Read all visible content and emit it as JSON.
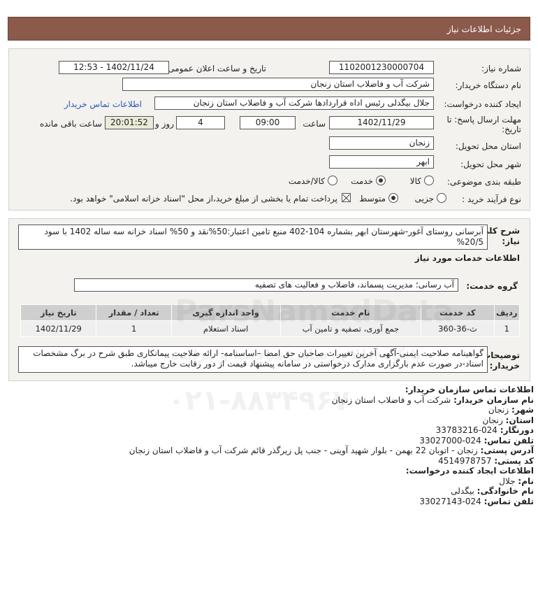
{
  "header": {
    "title": "جزئیات اطلاعات نیاز"
  },
  "form": {
    "need_number_label": "شماره نیاز:",
    "need_number": "1102001230000704",
    "announce_label": "تاریخ و ساعت اعلان عمومی:",
    "announce_value": "1402/11/24 - 12:53",
    "buyer_label": "نام دستگاه خریدار:",
    "buyer_value": "شرکت آب و فاضلاب استان زنجان",
    "creator_label": "ایجاد کننده درخواست:",
    "creator_value": "جلال بیگدلی رئیس اداه قراردادها شرکت آب و فاضلاب استان زنجان",
    "contact_link": "اطلاعات تماس خریدار",
    "deadline_label_1": "مهلت ارسال پاسخ: تا",
    "deadline_label_2": "تاریخ:",
    "deadline_date": "1402/11/29",
    "time_label": "ساعت",
    "deadline_time": "09:00",
    "days_value": "4",
    "days_label": "روز و",
    "remaining_time": "20:01:52",
    "remaining_label": "ساعت باقی مانده",
    "province_label": "استان محل تحویل:",
    "province_value": "زنجان",
    "city_label": "شهر محل تحویل:",
    "city_value": "ابهر",
    "category_label": "طبقه بندی موضوعی:",
    "category_options": [
      "کالا",
      "خدمت",
      "کالا/خدمت"
    ],
    "category_selected": "خدمت",
    "process_label": "نوع فرآیند خرید :",
    "process_options": [
      "جزیی",
      "متوسط"
    ],
    "process_selected": "متوسط",
    "payment_note": "پرداخت تمام یا بخشی از مبلغ خرید،از محل \"اسناد خزانه اسلامی\" خواهد بود."
  },
  "details": {
    "summary_label": "شرح کلی نیاز:",
    "summary_value": "آبرسانی روستای آغور-شهرستان ابهر بشماره 104-402 منبع تامین اعتبار:50%نقد و 50% اسناد خزانه سه ساله 1402 با سود 20/5%",
    "services_heading": "اطلاعات خدمات مورد نیاز",
    "service_group_label": "گروه خدمت:",
    "service_group_value": "آب رسانی؛ مدیریت پسماند، فاضلاب و فعالیت های تصفیه",
    "table": {
      "headers": [
        "ردیف",
        "کد خدمت",
        "نام خدمت",
        "واحد اندازه گیری",
        "تعداد / مقدار",
        "تاریخ نیاز"
      ],
      "rows": [
        [
          "1",
          "ث-36-360",
          "جمع آوری، تصفیه و تامین آب",
          "اسناد استعلام",
          "1",
          "1402/11/29"
        ]
      ]
    },
    "notes_label": "توضیحات خریدار:",
    "notes_value": "گواهینامه صلاحیت ایمنی-آگهی آخرین تغییرات صاحبان حق امضا –اساسنامه- ارائه صلاحیت پیمانکاری طبق شرح در برگ مشخصات اسناد-در صورت عدم بارگزاری مدارک درخواستی در سامانه پیشنهاد قیمت از دور رقابت خارج میباشد."
  },
  "contact": {
    "heading": "اطلاعات تماس سازمان خریدار:",
    "org_label": "نام سازمان خریدار:",
    "org_value": "شرکت آب و فاضلاب استان زنجان",
    "city_label": "شهر:",
    "city_value": "زنجان",
    "province_label": "استان:",
    "province_value": "زنجان",
    "fax_label": "دورنگار:",
    "fax_value": "024-33783216",
    "phone_label": "تلفن تماس:",
    "phone_value": "024-33027000",
    "address_label": "آدرس پستی:",
    "address_value": "زنجان - اتوبان 22 بهمن - بلوار شهید آوینی - جنب پل زیرگذر قائم شرکت آب و فاضلاب استان زنجان",
    "postal_label": "کد پستی:",
    "postal_value": "4514978757",
    "creator_heading": "اطلاعات ایجاد کننده درخواست:",
    "name_label": "نام:",
    "name_value": "جلال",
    "family_label": "نام خانوادگی:",
    "family_value": "بیگدلی",
    "creator_phone_label": "تلفن تماس:",
    "creator_phone_value": "024-33027143"
  },
  "watermark": {
    "brand": "ParsNamadData",
    "subtitle": "پایگاه اطلاع رسانی مناقصه و مزایده",
    "phone": "۰۲۱-۸۸۳۴۹۶۷۰"
  }
}
